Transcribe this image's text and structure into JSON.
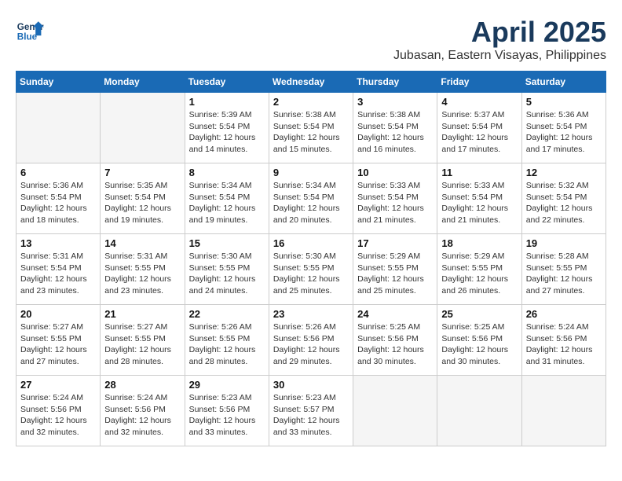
{
  "header": {
    "logo_line1": "General",
    "logo_line2": "Blue",
    "month_title": "April 2025",
    "subtitle": "Jubasan, Eastern Visayas, Philippines"
  },
  "weekdays": [
    "Sunday",
    "Monday",
    "Tuesday",
    "Wednesday",
    "Thursday",
    "Friday",
    "Saturday"
  ],
  "weeks": [
    [
      {
        "day": "",
        "info": ""
      },
      {
        "day": "",
        "info": ""
      },
      {
        "day": "1",
        "info": "Sunrise: 5:39 AM\nSunset: 5:54 PM\nDaylight: 12 hours and 14 minutes."
      },
      {
        "day": "2",
        "info": "Sunrise: 5:38 AM\nSunset: 5:54 PM\nDaylight: 12 hours and 15 minutes."
      },
      {
        "day": "3",
        "info": "Sunrise: 5:38 AM\nSunset: 5:54 PM\nDaylight: 12 hours and 16 minutes."
      },
      {
        "day": "4",
        "info": "Sunrise: 5:37 AM\nSunset: 5:54 PM\nDaylight: 12 hours and 17 minutes."
      },
      {
        "day": "5",
        "info": "Sunrise: 5:36 AM\nSunset: 5:54 PM\nDaylight: 12 hours and 17 minutes."
      }
    ],
    [
      {
        "day": "6",
        "info": "Sunrise: 5:36 AM\nSunset: 5:54 PM\nDaylight: 12 hours and 18 minutes."
      },
      {
        "day": "7",
        "info": "Sunrise: 5:35 AM\nSunset: 5:54 PM\nDaylight: 12 hours and 19 minutes."
      },
      {
        "day": "8",
        "info": "Sunrise: 5:34 AM\nSunset: 5:54 PM\nDaylight: 12 hours and 19 minutes."
      },
      {
        "day": "9",
        "info": "Sunrise: 5:34 AM\nSunset: 5:54 PM\nDaylight: 12 hours and 20 minutes."
      },
      {
        "day": "10",
        "info": "Sunrise: 5:33 AM\nSunset: 5:54 PM\nDaylight: 12 hours and 21 minutes."
      },
      {
        "day": "11",
        "info": "Sunrise: 5:33 AM\nSunset: 5:54 PM\nDaylight: 12 hours and 21 minutes."
      },
      {
        "day": "12",
        "info": "Sunrise: 5:32 AM\nSunset: 5:54 PM\nDaylight: 12 hours and 22 minutes."
      }
    ],
    [
      {
        "day": "13",
        "info": "Sunrise: 5:31 AM\nSunset: 5:54 PM\nDaylight: 12 hours and 23 minutes."
      },
      {
        "day": "14",
        "info": "Sunrise: 5:31 AM\nSunset: 5:55 PM\nDaylight: 12 hours and 23 minutes."
      },
      {
        "day": "15",
        "info": "Sunrise: 5:30 AM\nSunset: 5:55 PM\nDaylight: 12 hours and 24 minutes."
      },
      {
        "day": "16",
        "info": "Sunrise: 5:30 AM\nSunset: 5:55 PM\nDaylight: 12 hours and 25 minutes."
      },
      {
        "day": "17",
        "info": "Sunrise: 5:29 AM\nSunset: 5:55 PM\nDaylight: 12 hours and 25 minutes."
      },
      {
        "day": "18",
        "info": "Sunrise: 5:29 AM\nSunset: 5:55 PM\nDaylight: 12 hours and 26 minutes."
      },
      {
        "day": "19",
        "info": "Sunrise: 5:28 AM\nSunset: 5:55 PM\nDaylight: 12 hours and 27 minutes."
      }
    ],
    [
      {
        "day": "20",
        "info": "Sunrise: 5:27 AM\nSunset: 5:55 PM\nDaylight: 12 hours and 27 minutes."
      },
      {
        "day": "21",
        "info": "Sunrise: 5:27 AM\nSunset: 5:55 PM\nDaylight: 12 hours and 28 minutes."
      },
      {
        "day": "22",
        "info": "Sunrise: 5:26 AM\nSunset: 5:55 PM\nDaylight: 12 hours and 28 minutes."
      },
      {
        "day": "23",
        "info": "Sunrise: 5:26 AM\nSunset: 5:56 PM\nDaylight: 12 hours and 29 minutes."
      },
      {
        "day": "24",
        "info": "Sunrise: 5:25 AM\nSunset: 5:56 PM\nDaylight: 12 hours and 30 minutes."
      },
      {
        "day": "25",
        "info": "Sunrise: 5:25 AM\nSunset: 5:56 PM\nDaylight: 12 hours and 30 minutes."
      },
      {
        "day": "26",
        "info": "Sunrise: 5:24 AM\nSunset: 5:56 PM\nDaylight: 12 hours and 31 minutes."
      }
    ],
    [
      {
        "day": "27",
        "info": "Sunrise: 5:24 AM\nSunset: 5:56 PM\nDaylight: 12 hours and 32 minutes."
      },
      {
        "day": "28",
        "info": "Sunrise: 5:24 AM\nSunset: 5:56 PM\nDaylight: 12 hours and 32 minutes."
      },
      {
        "day": "29",
        "info": "Sunrise: 5:23 AM\nSunset: 5:56 PM\nDaylight: 12 hours and 33 minutes."
      },
      {
        "day": "30",
        "info": "Sunrise: 5:23 AM\nSunset: 5:57 PM\nDaylight: 12 hours and 33 minutes."
      },
      {
        "day": "",
        "info": ""
      },
      {
        "day": "",
        "info": ""
      },
      {
        "day": "",
        "info": ""
      }
    ]
  ]
}
